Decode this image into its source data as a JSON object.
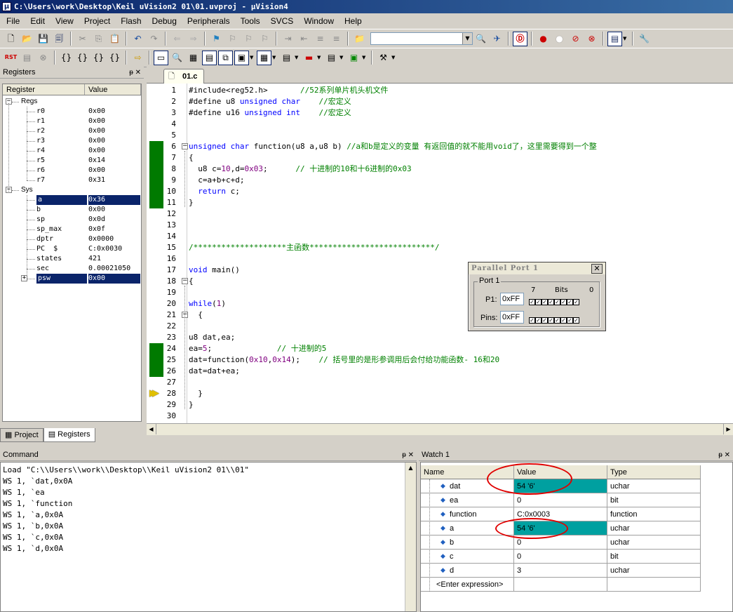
{
  "window": {
    "title": "C:\\Users\\work\\Desktop\\Keil uVision2 01\\01.uvproj - µVision4"
  },
  "menu": [
    "File",
    "Edit",
    "View",
    "Project",
    "Flash",
    "Debug",
    "Peripherals",
    "Tools",
    "SVCS",
    "Window",
    "Help"
  ],
  "registers": {
    "panel_title": "Registers",
    "col_register": "Register",
    "col_value": "Value",
    "groups": [
      {
        "name": "Regs",
        "items": [
          {
            "name": "r0",
            "value": "0x00"
          },
          {
            "name": "r1",
            "value": "0x00"
          },
          {
            "name": "r2",
            "value": "0x00"
          },
          {
            "name": "r3",
            "value": "0x00"
          },
          {
            "name": "r4",
            "value": "0x00"
          },
          {
            "name": "r5",
            "value": "0x14"
          },
          {
            "name": "r6",
            "value": "0x00"
          },
          {
            "name": "r7",
            "value": "0x31"
          }
        ]
      },
      {
        "name": "Sys",
        "items": [
          {
            "name": "a",
            "value": "0x36",
            "selected": true
          },
          {
            "name": "b",
            "value": "0x00"
          },
          {
            "name": "sp",
            "value": "0x0d"
          },
          {
            "name": "sp_max",
            "value": "0x0f"
          },
          {
            "name": "dptr",
            "value": "0x0000"
          },
          {
            "name": "PC  $",
            "value": "C:0x0030"
          },
          {
            "name": "states",
            "value": "421"
          },
          {
            "name": "sec",
            "value": "0.00021050"
          },
          {
            "name": "psw",
            "value": "0x00",
            "selected": true
          }
        ]
      }
    ],
    "tabs": [
      "Project",
      "Registers"
    ]
  },
  "editor": {
    "file_tab": "01.c",
    "lines": [
      {
        "n": "1",
        "code": "#include<reg52.h>       ",
        "comment": "//52系列单片机头机文件"
      },
      {
        "n": "2",
        "code": "#define u8 unsigned char    ",
        "comment": "//宏定义"
      },
      {
        "n": "3",
        "code": "#define u16 unsigned int    ",
        "comment": "//宏定义"
      },
      {
        "n": "4",
        "code": "",
        "comment": ""
      },
      {
        "n": "5",
        "code": "",
        "comment": ""
      },
      {
        "n": "6",
        "code": "unsigned char function(u8 a,u8 b) ",
        "comment": "//a和b是定义的变量 有返回值的就不能用void了，这里需要得到一个整",
        "cov": true
      },
      {
        "n": "7",
        "code": "{",
        "comment": "",
        "cov": true
      },
      {
        "n": "8",
        "code": "  u8 c=10,d=0x03;      ",
        "comment": "// 十进制的10和十6进制的0x03",
        "cov": true
      },
      {
        "n": "9",
        "code": "  c=a+b+c+d;",
        "comment": "",
        "cov": true
      },
      {
        "n": "10",
        "code": "  return c;",
        "comment": "",
        "cov": true
      },
      {
        "n": "11",
        "code": "}",
        "comment": "",
        "cov": true
      },
      {
        "n": "12",
        "code": "",
        "comment": ""
      },
      {
        "n": "13",
        "code": "",
        "comment": ""
      },
      {
        "n": "14",
        "code": "",
        "comment": ""
      },
      {
        "n": "15",
        "code": "",
        "comment": "/********************主函数***************************/"
      },
      {
        "n": "16",
        "code": "",
        "comment": ""
      },
      {
        "n": "17",
        "code": "void main()",
        "comment": ""
      },
      {
        "n": "18",
        "code": "{",
        "comment": ""
      },
      {
        "n": "19",
        "code": "",
        "comment": ""
      },
      {
        "n": "20",
        "code": "while(1)",
        "comment": ""
      },
      {
        "n": "21",
        "code": "  {",
        "comment": ""
      },
      {
        "n": "22",
        "code": "",
        "comment": ""
      },
      {
        "n": "23",
        "code": "u8 dat,ea;",
        "comment": ""
      },
      {
        "n": "24",
        "code": "ea=5;              ",
        "comment": "// 十进制的5",
        "cov": true
      },
      {
        "n": "25",
        "code": "dat=function(0x10,0x14);    ",
        "comment": "// 括号里的是形参调用后会付给功能函数- 16和20",
        "cov": true
      },
      {
        "n": "26",
        "code": "dat=dat+ea;",
        "comment": "",
        "cov": true
      },
      {
        "n": "27",
        "code": "",
        "comment": ""
      },
      {
        "n": "28",
        "code": "  }",
        "comment": "",
        "arrow": true
      },
      {
        "n": "29",
        "code": "}",
        "comment": ""
      },
      {
        "n": "30",
        "code": "",
        "comment": ""
      }
    ]
  },
  "parallel_port": {
    "title": "Parallel Port 1",
    "group": "Port 1",
    "bits_label": "Bits",
    "bit_hi": "7",
    "bit_lo": "0",
    "p1_label": "P1:",
    "p1_value": "0xFF",
    "pins_label": "Pins:",
    "pins_value": "0xFF"
  },
  "command": {
    "title": "Command",
    "lines": [
      "Load \"C:\\\\Users\\\\work\\\\Desktop\\\\Keil uVision2 01\\\\01\"",
      "WS 1, `dat,0x0A",
      "WS 1, `ea",
      "WS 1, `function",
      "WS 1, `a,0x0A",
      "WS 1, `b,0x0A",
      "WS 1, `c,0x0A",
      "WS 1, `d,0x0A"
    ]
  },
  "watch": {
    "title": "Watch 1",
    "col_name": "Name",
    "col_value": "Value",
    "col_type": "Type",
    "rows": [
      {
        "name": "dat",
        "value": "54 '6'",
        "type": "uchar",
        "hl": true
      },
      {
        "name": "ea",
        "value": "0",
        "type": "bit"
      },
      {
        "name": "function",
        "value": "C:0x0003",
        "type": "function"
      },
      {
        "name": "a",
        "value": "54 '6'",
        "type": "uchar",
        "hl": true
      },
      {
        "name": "b",
        "value": "0",
        "type": "uchar"
      },
      {
        "name": "c",
        "value": "0",
        "type": "bit"
      },
      {
        "name": "d",
        "value": "3",
        "type": "uchar"
      }
    ],
    "enter_expression": "<Enter expression>",
    "highlight_color": "#00a0a0",
    "annotation_color": "#e00000"
  }
}
